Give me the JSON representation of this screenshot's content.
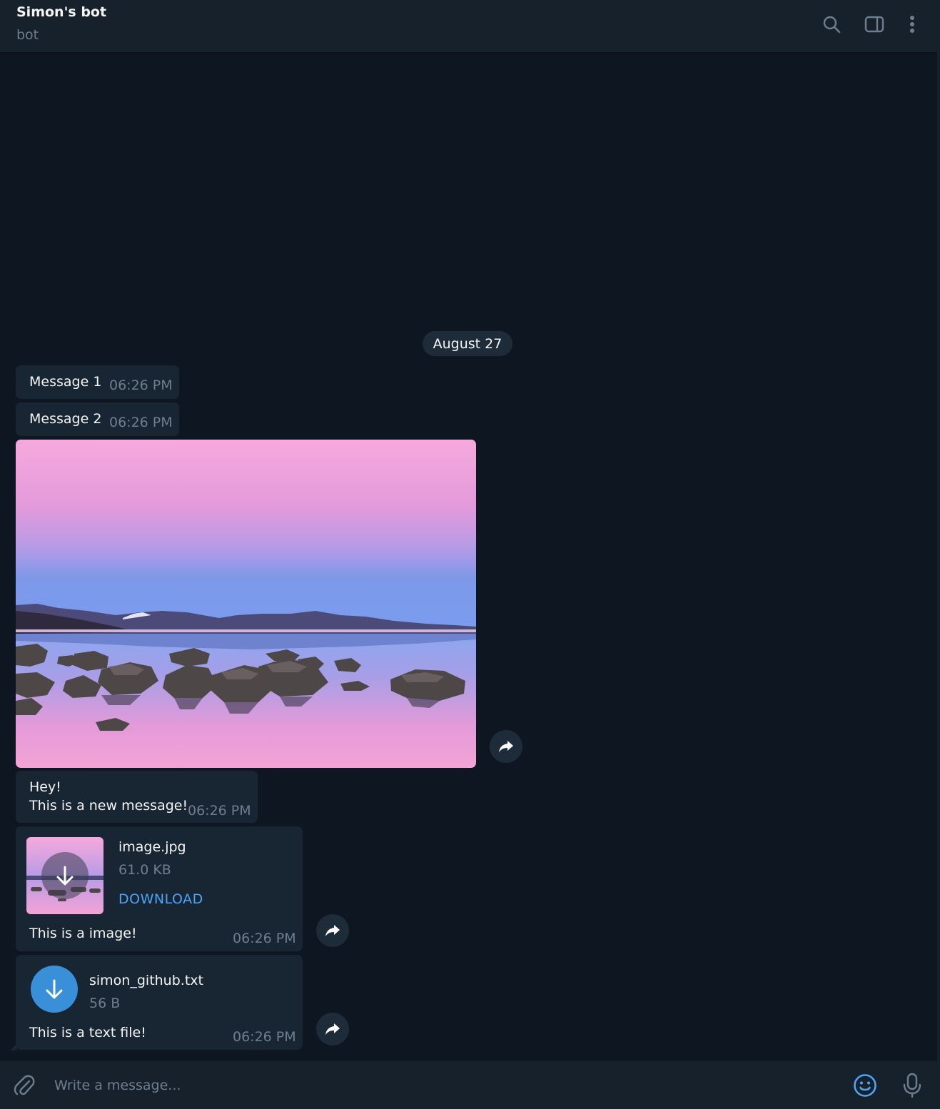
{
  "header": {
    "title": "Simon's bot",
    "subtitle": "bot",
    "icons": [
      "search-icon",
      "sidebar-toggle-icon",
      "more-vertical-icon"
    ]
  },
  "date_separator": "August 27",
  "messages": [
    {
      "text": "Message 1",
      "time": "06:26 PM"
    },
    {
      "text": "Message 2",
      "time": "06:26 PM"
    },
    {
      "type": "photo",
      "description_icon": "share-icon"
    },
    {
      "text": "Hey!\nThis is a new message!",
      "time": "06:26 PM"
    },
    {
      "type": "document",
      "file_name": "image.jpg",
      "file_size": "61.0 KB",
      "action": "DOWNLOAD",
      "caption": "This is a image!",
      "time": "06:26 PM"
    },
    {
      "type": "document",
      "file_name": "simon_github.txt",
      "file_size": "56 B",
      "caption": "This is a text file!",
      "time": "06:26 PM"
    }
  ],
  "composer": {
    "placeholder": "Write a message...",
    "icons": [
      "attach-icon",
      "emoji-icon",
      "microphone-icon"
    ]
  },
  "colors": {
    "background": "#0e1621",
    "bubble": "#182533",
    "header": "#17212b",
    "accent": "#4ea4f6",
    "muted_text": "#6d7f8f"
  }
}
